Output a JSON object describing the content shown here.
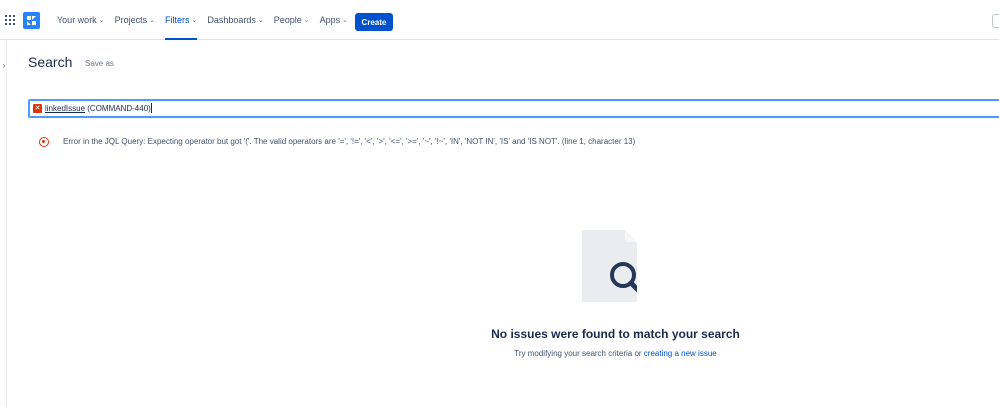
{
  "nav": {
    "items": [
      {
        "label": "Your work",
        "chevron": true,
        "active": false
      },
      {
        "label": "Projects",
        "chevron": true,
        "active": false
      },
      {
        "label": "Filters",
        "chevron": true,
        "active": true
      },
      {
        "label": "Dashboards",
        "chevron": true,
        "active": false
      },
      {
        "label": "People",
        "chevron": true,
        "active": false
      },
      {
        "label": "Apps",
        "chevron": true,
        "active": false
      }
    ],
    "create_label": "Create",
    "accent": "#0052cc"
  },
  "page": {
    "title": "Search",
    "save_as": "Save as"
  },
  "jql": {
    "keyword": "linkedIssue",
    "rest": " (COMMAND-440)",
    "status_icon": "error-icon"
  },
  "error": {
    "message": "Error in the JQL Query: Expecting operator but got '('. The valid operators are '=', '!=', '<', '>', '<=', '>=', '~', '!~', 'IN', 'NOT IN', 'IS' and 'IS NOT'. (line 1, character 13)",
    "color": "#de350b"
  },
  "empty_state": {
    "title": "No issues were found to match your search",
    "subtitle_prefix": "Try modifying your search criteria or ",
    "link": "creating a new issue"
  }
}
